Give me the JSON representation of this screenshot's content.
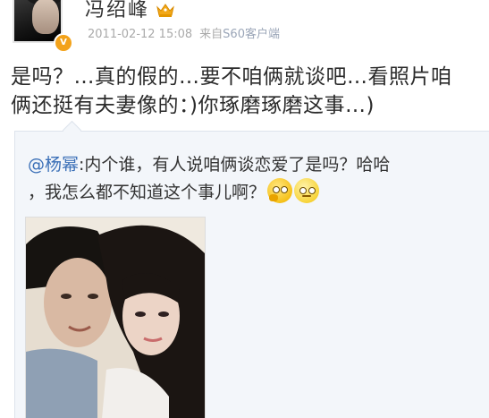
{
  "post": {
    "username": "冯绍峰",
    "user_badge": "V",
    "time": "2011-02-12 15:08",
    "source_prefix": "来自",
    "source_name": "S60客户端",
    "text_line_1": "是吗？…真的假的…要不咱俩就谈吧…看照片咱",
    "text_line_2": "俩还挺有夫妻像的：)你琢磨琢磨这事…)"
  },
  "repost": {
    "mention": "@杨幂",
    "text_line_1_rest": ":内个谁，有人说咱俩谈恋爱了是吗？哈哈",
    "text_line_2": "，我怎么都不知道这个事儿啊？"
  },
  "icons": {
    "crown": "crown-icon",
    "verified": "verified-badge-icon",
    "emoji_1": "thinking-face-icon",
    "emoji_2": "dizzy-face-icon"
  },
  "colors": {
    "link": "#3a6fb7",
    "badge": "#f3a21a",
    "crown": "#f2a818",
    "repost_bg": "#f3f6fa"
  }
}
